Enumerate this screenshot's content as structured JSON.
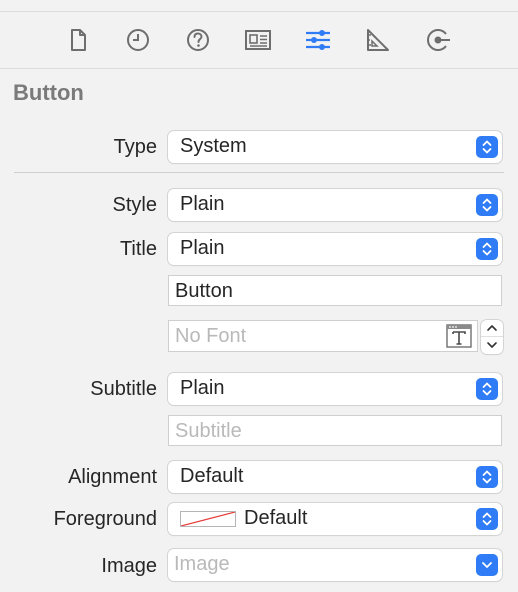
{
  "toolbar": {
    "tabs": [
      {
        "icon": "file-inspector-icon"
      },
      {
        "icon": "history-inspector-icon"
      },
      {
        "icon": "quick-help-icon"
      },
      {
        "icon": "identity-inspector-icon"
      },
      {
        "icon": "attributes-inspector-icon",
        "selected": true,
        "color": "#2f7cf6"
      },
      {
        "icon": "size-inspector-icon"
      },
      {
        "icon": "connections-inspector-icon"
      }
    ]
  },
  "section": {
    "title": "Button"
  },
  "fields": {
    "type": {
      "label": "Type",
      "value": "System"
    },
    "style": {
      "label": "Style",
      "value": "Plain"
    },
    "title": {
      "label": "Title",
      "value": "Plain",
      "text_value": "Button",
      "font_placeholder": "No Font"
    },
    "subtitle": {
      "label": "Subtitle",
      "value": "Plain",
      "placeholder": "Subtitle"
    },
    "alignment": {
      "label": "Alignment",
      "value": "Default"
    },
    "foreground": {
      "label": "Foreground",
      "value": "Default"
    },
    "image": {
      "label": "Image",
      "placeholder": "Image"
    }
  },
  "colors": {
    "accent": "#2f7cf6",
    "swatch_slash": "#e53935"
  }
}
